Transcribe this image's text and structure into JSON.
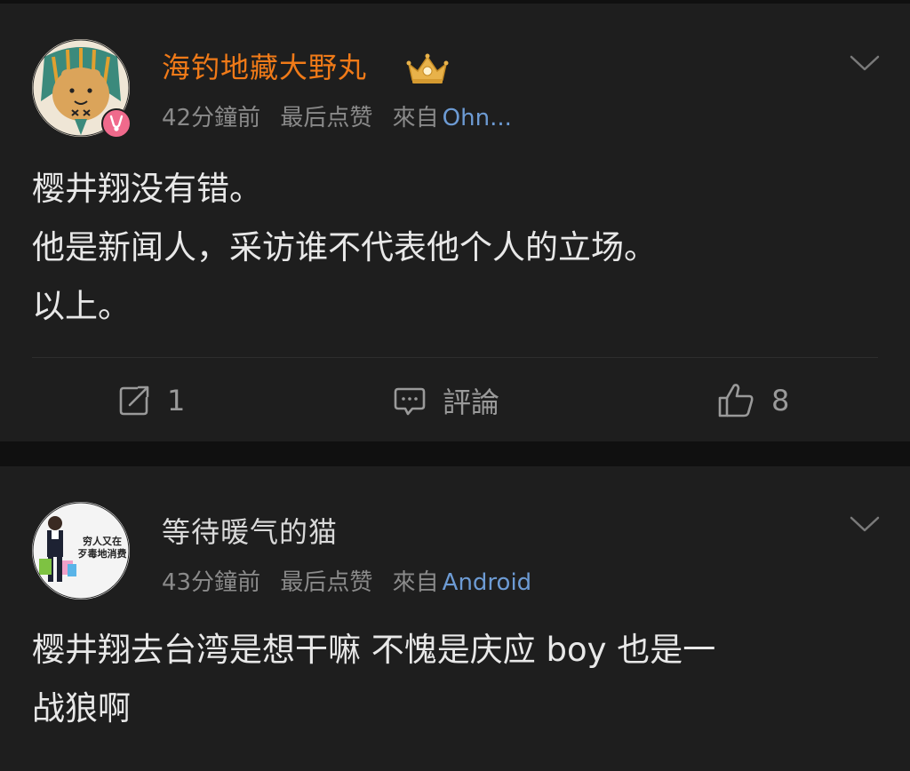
{
  "posts": [
    {
      "username": "海钓地藏大野丸",
      "meta": {
        "time": "42分鐘前",
        "last_like": "最后点赞",
        "source_prefix": "來自",
        "source": "Ohn..."
      },
      "body": [
        "樱井翔没有错。",
        "他是新闻人，采访谁不代表他个人的立场。",
        "以上。"
      ],
      "actions": {
        "repost_count": "1",
        "comment_label": "評論",
        "like_count": "8"
      },
      "colors": {
        "username": "#f07a18"
      }
    },
    {
      "username": "等待暖气的猫",
      "avatar_text": [
        "穷人又在",
        "歹毒地消费"
      ],
      "meta": {
        "time": "43分鐘前",
        "last_like": "最后点赞",
        "source_prefix": "來自",
        "source": "Android"
      },
      "body": [
        "樱井翔去台湾是想干嘛 不愧是庆应 boy 也是一",
        "战狼啊"
      ]
    }
  ],
  "colors": {
    "background": "#101010",
    "card": "#1e1e1e",
    "meta_text": "#8a8a8a",
    "source_link": "#6d9bd4",
    "badge": "#f06a8c"
  },
  "icons": {
    "vip": "crown-badge-icon",
    "badge": "member-badge-icon",
    "more": "chevron-down-icon",
    "repost": "repost-icon",
    "comment": "comment-icon",
    "like": "thumbs-up-icon"
  }
}
